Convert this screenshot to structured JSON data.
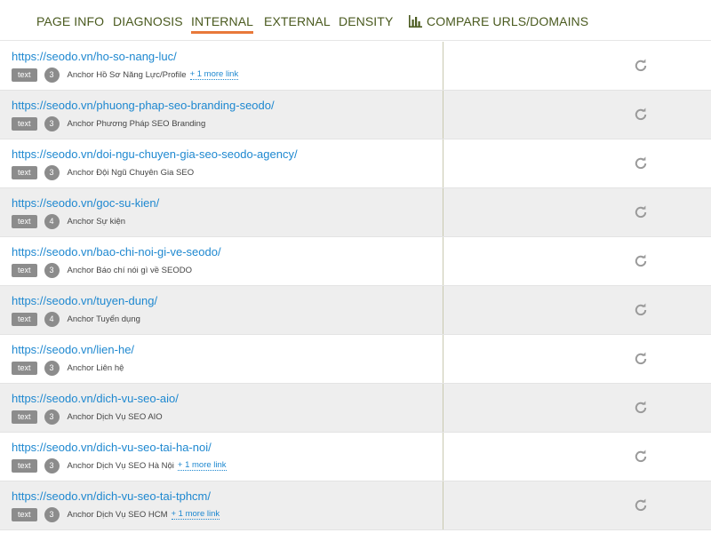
{
  "nav": {
    "tabs": [
      {
        "label": "PAGE INFO",
        "active": false
      },
      {
        "label": "DIAGNOSIS",
        "active": false
      },
      {
        "label": "INTERNAL",
        "active": true
      },
      {
        "label": "EXTERNAL",
        "active": false
      },
      {
        "label": "DENSITY",
        "active": false
      },
      {
        "label": "COMPARE URLS/DOMAINS",
        "active": false,
        "icon": "bar-chart-icon"
      }
    ],
    "accent_color": "#e8793a",
    "tab_color": "#4a5a1f"
  },
  "links": [
    {
      "url": "https://seodo.vn/ho-so-nang-luc/",
      "type": "text",
      "count": "3",
      "anchor": "Anchor Hồ Sơ Năng Lực/Profile",
      "more": "+ 1 more link"
    },
    {
      "url": "https://seodo.vn/phuong-phap-seo-branding-seodo/",
      "type": "text",
      "count": "3",
      "anchor": "Anchor Phương Pháp SEO Branding",
      "more": null
    },
    {
      "url": "https://seodo.vn/doi-ngu-chuyen-gia-seo-seodo-agency/",
      "type": "text",
      "count": "3",
      "anchor": "Anchor Đội Ngũ Chuyên Gia SEO",
      "more": null
    },
    {
      "url": "https://seodo.vn/goc-su-kien/",
      "type": "text",
      "count": "4",
      "anchor": "Anchor Sự kiện",
      "more": null
    },
    {
      "url": "https://seodo.vn/bao-chi-noi-gi-ve-seodo/",
      "type": "text",
      "count": "3",
      "anchor": "Anchor Báo chí nói gì về SEODO",
      "more": null
    },
    {
      "url": "https://seodo.vn/tuyen-dung/",
      "type": "text",
      "count": "4",
      "anchor": "Anchor Tuyển dụng",
      "more": null
    },
    {
      "url": "https://seodo.vn/lien-he/",
      "type": "text",
      "count": "3",
      "anchor": "Anchor Liên hệ",
      "more": null
    },
    {
      "url": "https://seodo.vn/dich-vu-seo-aio/",
      "type": "text",
      "count": "3",
      "anchor": "Anchor Dịch Vụ SEO AIO",
      "more": null
    },
    {
      "url": "https://seodo.vn/dich-vu-seo-tai-ha-noi/",
      "type": "text",
      "count": "3",
      "anchor": "Anchor Dịch Vụ SEO Hà Nội",
      "more": "+ 1 more link"
    },
    {
      "url": "https://seodo.vn/dich-vu-seo-tai-tphcm/",
      "type": "text",
      "count": "3",
      "anchor": "Anchor Dịch Vụ SEO HCM",
      "more": "+ 1 more link"
    }
  ],
  "icons": {
    "refresh": "refresh-icon",
    "compare": "bar-chart-icon"
  },
  "colors": {
    "link": "#1e88d0",
    "badge": "#8c8c8c",
    "row_alt": "#eeeeee"
  }
}
